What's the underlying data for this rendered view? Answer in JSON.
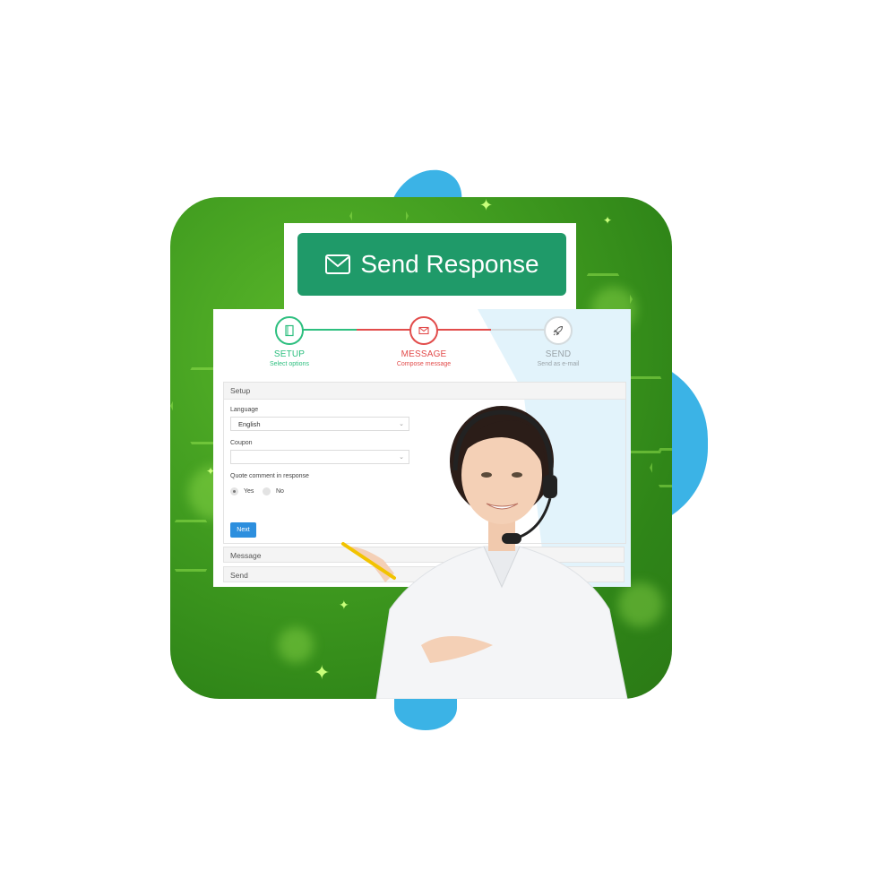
{
  "hero_button": {
    "label": "Send Response",
    "icon": "envelope-icon",
    "color": "#1f9a69"
  },
  "wizard": {
    "steps": [
      {
        "title": "SETUP",
        "subtitle": "Select options",
        "icon": "notebook-icon",
        "state": "done",
        "color": "#2dbf7f"
      },
      {
        "title": "MESSAGE",
        "subtitle": "Compose message",
        "icon": "envelope-icon",
        "state": "active",
        "color": "#e24c4b"
      },
      {
        "title": "SEND",
        "subtitle": "Send as e-mail",
        "icon": "rocket-icon",
        "state": "pending",
        "color": "#9aa3a8"
      }
    ],
    "setup_panel": {
      "heading": "Setup",
      "language_label": "Language",
      "language_value": "English",
      "coupon_label": "Coupon",
      "coupon_value": "",
      "quote_label": "Quote comment in response",
      "options": [
        {
          "label": "Yes",
          "selected": true
        },
        {
          "label": "No",
          "selected": false
        }
      ],
      "next_label": "Next",
      "next_color": "#2d8fde"
    },
    "message_panel": {
      "heading": "Message"
    },
    "send_panel": {
      "heading": "Send"
    }
  },
  "decor": {
    "panel_color": "#3f9a1f",
    "blob_color": "#3bb3e6",
    "person": "support agent with headset holding pencil"
  }
}
